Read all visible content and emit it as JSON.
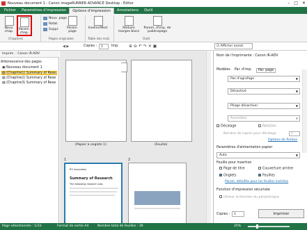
{
  "window": {
    "title": "Nouveau document 1 - Canon imageRUNNER ADVANCE Desktop - Editor"
  },
  "tabs": [
    "Fichier",
    "Paramètres d'impression",
    "Options d'impression",
    "Annotations",
    "Outil"
  ],
  "ribbon": {
    "new_chapter": "Nouv. chap.",
    "change_chapter": "Param. chap.",
    "chapters_group": "Chapitres",
    "new_page": "Nouv. page",
    "rotate": "Rotat.",
    "delete": "Suppr.",
    "param_page": "Param. page",
    "orig_pages_group": "Pages originales",
    "insert_tab": "Insérer/Mod.",
    "tab_table_group": "Table des mat.",
    "reduce_margins": "Réduire marges blocs",
    "param_publicity": "Param. d'imp. de publicopage",
    "tool_group": "Outil"
  },
  "toolbar": {
    "copies_label": "Copies :",
    "copies_value": "1",
    "print_label": "Imp.",
    "show_annot": "Afficher annot."
  },
  "left": {
    "printer": "Imprim. : Canon iR-ADV",
    "tree_label": "Arborescence des pages",
    "items": [
      "Nouveau document 1",
      "(Chapitre1) Summary of Rese",
      "(Chapitre2) Summary of Rese",
      "(Chapitre3) Summary of Rese"
    ]
  },
  "center": {
    "page1_caption": "(Papier à onglets 1)",
    "page2_caption": "(Feuille)",
    "page3_num": "1",
    "page4_num": "2",
    "doc_title": "Summary of Research",
    "doc_org": "R3 Innovation",
    "doc_sub": "The following research was"
  },
  "right": {
    "printer_label": "Nom de l'imprimante : Canon iR-ADV",
    "subtabs": [
      "Modèles",
      "Par. d'imp.",
      "Par. page"
    ],
    "binding": "Pas d'agrafage",
    "option2": "Désactivé",
    "staple": "Pliage désactiver",
    "assembler": "Assembler",
    "offset": "Décalage",
    "rotation": "Rotation",
    "sets_label": "Nombre de copies pour décalage",
    "sets_value": "1",
    "finishing_link": "Options de finition",
    "feed_label": "Paramètres d'alimentation papier",
    "feed_value": "Auto",
    "insert_label": "Feuille pour insertion",
    "cover": "Page de titre",
    "back_cover": "Couverture arrière",
    "tabs_label": "Onglets",
    "sheets_label": "Feuilles",
    "details_link": "Param. détaillés pour les feuilles insérées",
    "secure_label": "Fonction d'impression sécurisée",
    "secure_check": "Utiliser la fonction du périphérique",
    "copies_label": "Copies :",
    "copies_value": "1",
    "print_btn": "Imprimer"
  },
  "status": {
    "selected": "Page sélectionnée : 1/33",
    "format": "Format de sortie A4",
    "total": "Nombre total de feuilles : 39",
    "zoom": "25%"
  },
  "colors": {
    "accent": "#217346",
    "highlight": "#c33",
    "selection": "#ffe08a"
  }
}
